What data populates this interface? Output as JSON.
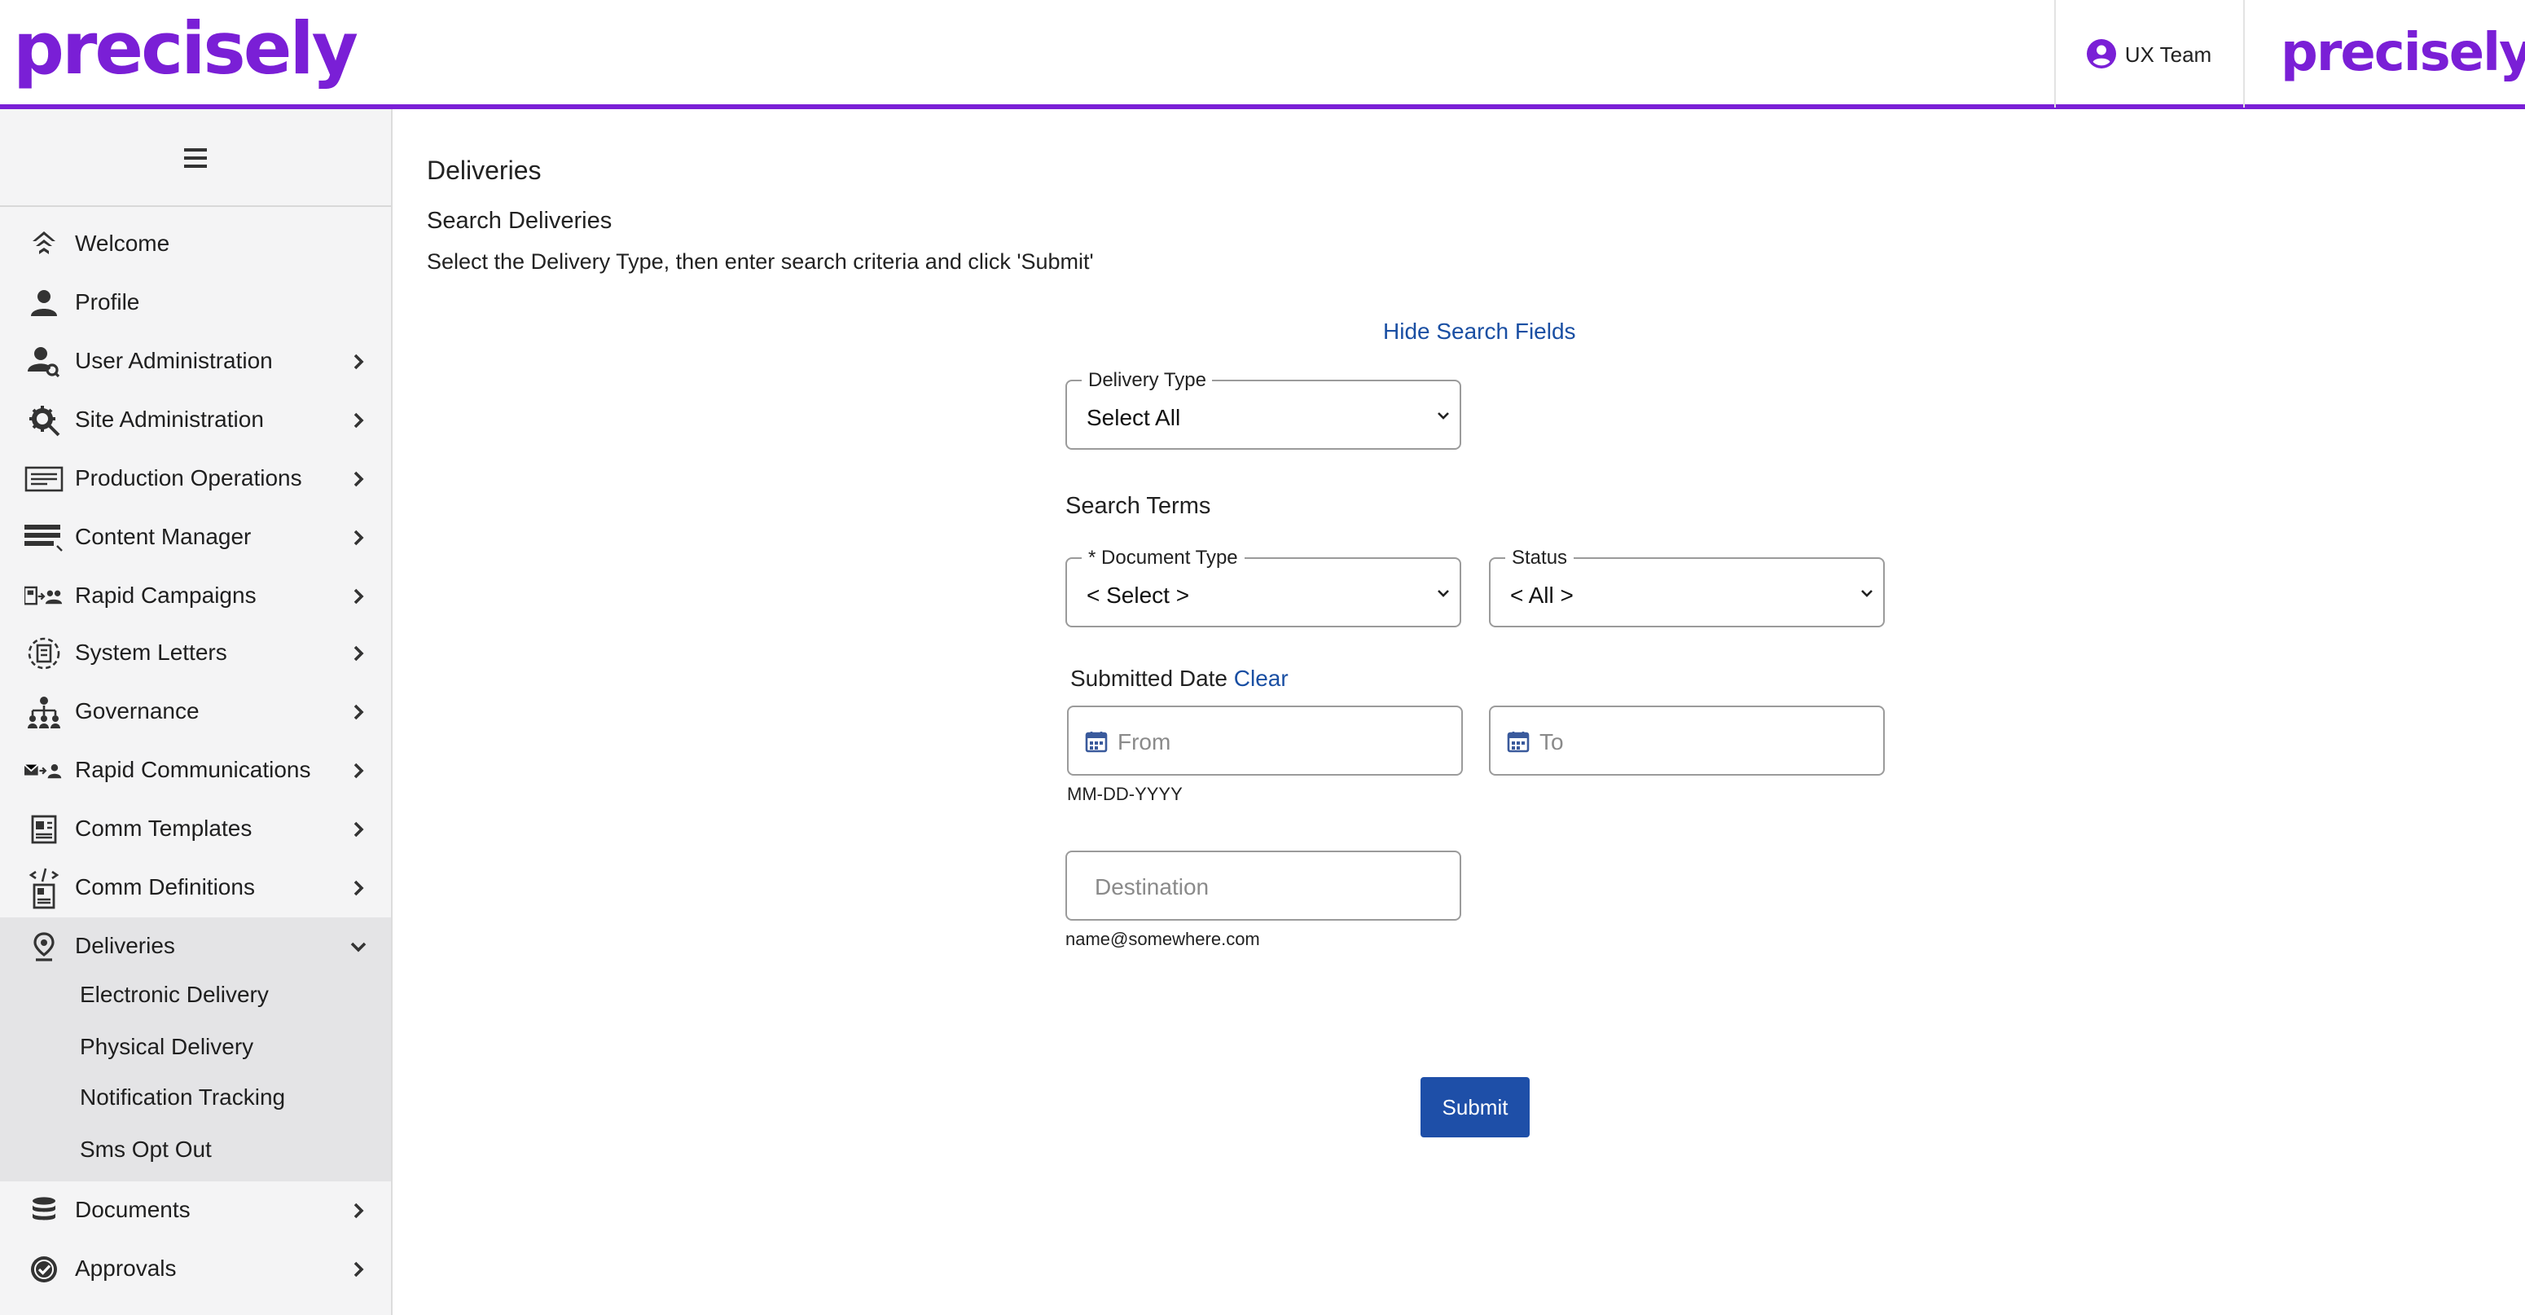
{
  "header": {
    "logo_text": "precisely",
    "user_name": "UX Team",
    "brand_logo_text": "precisely",
    "accent_color": "#7a1fd6"
  },
  "sidebar": {
    "menu_icon": "hamburger-icon",
    "items": [
      {
        "label": "Welcome",
        "icon": "welcome-icon",
        "has_children": false
      },
      {
        "label": "Profile",
        "icon": "profile-icon",
        "has_children": false
      },
      {
        "label": "User Administration",
        "icon": "user-admin-icon",
        "has_children": true
      },
      {
        "label": "Site Administration",
        "icon": "site-admin-gear-icon",
        "has_children": true
      },
      {
        "label": "Production Operations",
        "icon": "production-operations-icon",
        "has_children": true
      },
      {
        "label": "Content Manager",
        "icon": "content-manager-icon",
        "has_children": true
      },
      {
        "label": "Rapid Campaigns",
        "icon": "rapid-campaigns-icon",
        "has_children": true
      },
      {
        "label": "System Letters",
        "icon": "system-letters-icon",
        "has_children": true
      },
      {
        "label": "Governance",
        "icon": "governance-icon",
        "has_children": true
      },
      {
        "label": "Rapid Communications",
        "icon": "rapid-communications-icon",
        "has_children": true
      },
      {
        "label": "Comm Templates",
        "icon": "comm-templates-icon",
        "has_children": true
      },
      {
        "label": "Comm Definitions",
        "icon": "comm-definitions-icon",
        "has_children": true
      },
      {
        "label": "Deliveries",
        "icon": "location-pin-icon",
        "has_children": true,
        "expanded": true
      },
      {
        "label": "Documents",
        "icon": "database-icon",
        "has_children": true
      },
      {
        "label": "Approvals",
        "icon": "approval-badge-icon",
        "has_children": true
      }
    ],
    "deliveries_submenu": [
      "Electronic Delivery",
      "Physical Delivery",
      "Notification Tracking",
      "Sms Opt Out"
    ]
  },
  "main": {
    "title": "Deliveries",
    "subtitle": "Search Deliveries",
    "instructions": "Select the Delivery Type, then enter search criteria and click 'Submit'",
    "hide_search_fields": "Hide Search Fields",
    "delivery_type": {
      "label": "Delivery Type",
      "value": "Select All"
    },
    "search_terms_heading": "Search Terms",
    "document_type": {
      "label": "* Document Type",
      "value": "< Select >"
    },
    "status": {
      "label": "Status",
      "value": "< All >"
    },
    "submitted_date": {
      "label": "Submitted Date",
      "clear": "Clear",
      "from_placeholder": "From",
      "to_placeholder": "To",
      "format_hint": "MM-DD-YYYY"
    },
    "destination": {
      "placeholder": "Destination",
      "hint": "name@somewhere.com"
    },
    "submit_label": "Submit",
    "link_color": "#1a4fa3",
    "button_color": "#1e4fa8"
  }
}
